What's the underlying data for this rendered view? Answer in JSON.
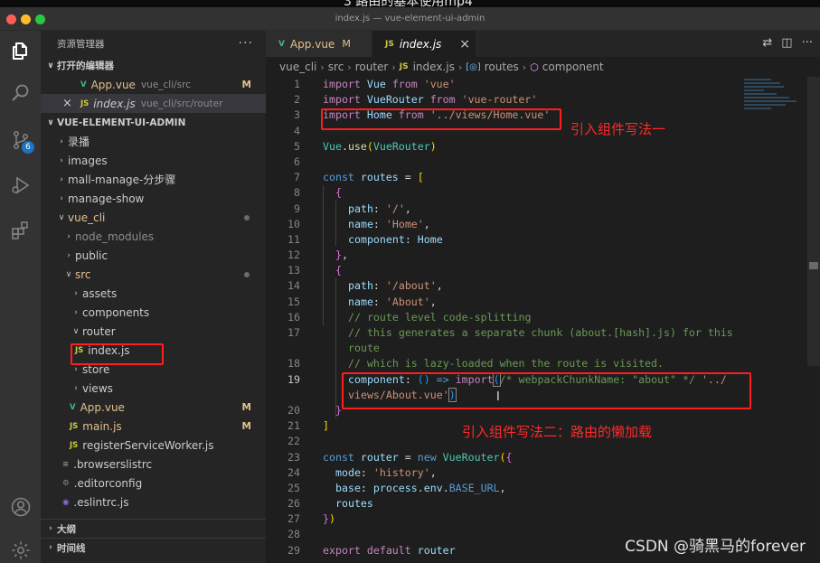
{
  "caption_text": "3 路由的基本使用mp4",
  "window_title": "index.js — vue-element-ui-admin",
  "activity_bar": {
    "icons": [
      "files-icon",
      "search-icon",
      "source-control-icon",
      "run-debug-icon",
      "extensions-icon",
      "account-icon",
      "settings-gear-icon"
    ],
    "scm_badge": "6"
  },
  "sidebar": {
    "title": "资源管理器",
    "more": "···",
    "open_editors_title": "打开的编辑器",
    "open_editors": [
      {
        "name": "App.vue",
        "path": "vue_cli/src",
        "status": "M",
        "icon": "V"
      },
      {
        "name": "index.js",
        "path": "vue_cli/src/router",
        "status": "",
        "icon": "JS",
        "close": "×"
      }
    ],
    "project_title": "VUE-ELEMENT-UI-ADMIN",
    "tree": [
      {
        "label": "录播",
        "kind": "folder"
      },
      {
        "label": "images",
        "kind": "folder"
      },
      {
        "label": "mall-manage-分步骤",
        "kind": "folder"
      },
      {
        "label": "manage-show",
        "kind": "folder"
      },
      {
        "label": "vue_cli",
        "kind": "folder-open"
      },
      {
        "label": "node_modules",
        "kind": "folder"
      },
      {
        "label": "public",
        "kind": "folder"
      },
      {
        "label": "src",
        "kind": "folder-open"
      },
      {
        "label": "assets",
        "kind": "folder"
      },
      {
        "label": "components",
        "kind": "folder"
      },
      {
        "label": "router",
        "kind": "folder-open"
      },
      {
        "label": "index.js",
        "kind": "js"
      },
      {
        "label": "store",
        "kind": "folder"
      },
      {
        "label": "views",
        "kind": "folder"
      },
      {
        "label": "App.vue",
        "kind": "vue",
        "status": "M"
      },
      {
        "label": "main.js",
        "kind": "js",
        "status": "M"
      },
      {
        "label": "registerServiceWorker.js",
        "kind": "js"
      },
      {
        "label": ".browserslistrc",
        "kind": "cfg"
      },
      {
        "label": ".editorconfig",
        "kind": "cfg"
      },
      {
        "label": ".eslintrc.js",
        "kind": "cfg"
      }
    ],
    "outline_title": "大纲",
    "timeline_title": "时间线"
  },
  "editor": {
    "tabs": [
      {
        "label": "App.vue",
        "icon": "V",
        "status": "M"
      },
      {
        "label": "index.js",
        "icon": "JS",
        "close": "×"
      }
    ],
    "breadcrumbs": [
      "vue_cli",
      "src",
      "router",
      "index.js",
      "routes",
      "component"
    ],
    "breadcrumb_icons": {
      "file": "JS",
      "symbol1": "[◎]",
      "symbol2": "⬡"
    },
    "line_numbers": [
      "1",
      "2",
      "3",
      "4",
      "5",
      "6",
      "7",
      "8",
      "9",
      "10",
      "11",
      "12",
      "13",
      "14",
      "15",
      "16",
      "17",
      "",
      "18",
      "19",
      "",
      "20",
      "21",
      "22",
      "23",
      "24",
      "25",
      "26",
      "27",
      "28",
      "29"
    ],
    "code": {
      "l1": [
        "import",
        " ",
        "Vue",
        " ",
        "from",
        " ",
        "'vue'"
      ],
      "l2": [
        "import",
        " ",
        "VueRouter",
        " ",
        "from",
        " ",
        "'vue-router'"
      ],
      "l3": [
        "import",
        " ",
        "Home",
        " ",
        "from",
        " ",
        "'../views/Home.vue'"
      ],
      "l5": [
        "Vue",
        ".",
        "use",
        "(",
        "VueRouter",
        ")"
      ],
      "l7": [
        "const",
        " ",
        "routes",
        " = ",
        "["
      ],
      "l8": [
        "{"
      ],
      "l9": [
        "path",
        ": ",
        "'/'",
        ","
      ],
      "l10": [
        "name",
        ": ",
        "'Home'",
        ","
      ],
      "l11": [
        "component",
        ": ",
        "Home"
      ],
      "l12": [
        "}",
        ","
      ],
      "l13": [
        "{"
      ],
      "l14": [
        "path",
        ": ",
        "'/about'",
        ","
      ],
      "l15": [
        "name",
        ": ",
        "'About'",
        ","
      ],
      "l16": [
        "// route level code-splitting"
      ],
      "l17a": [
        "// this generates a separate chunk (about.[hash].js) for this"
      ],
      "l17b": [
        "route"
      ],
      "l18": [
        "// which is lazy-loaded when the route is visited."
      ],
      "l19a": [
        "component",
        ": ",
        "()",
        " => ",
        "import",
        "(",
        "/* webpackChunkName: \"about\" */",
        " ",
        "'../"
      ],
      "l19b": [
        "views/About.vue'",
        ")"
      ],
      "l20": [
        "}"
      ],
      "l21": [
        "]"
      ],
      "l23": [
        "const",
        " ",
        "router",
        " = ",
        "new",
        " ",
        "VueRouter",
        "(",
        "{"
      ],
      "l24": [
        "mode",
        ": ",
        "'history'",
        ","
      ],
      "l25": [
        "base",
        ": ",
        "process",
        ".",
        "env",
        ".",
        "BASE_URL",
        ","
      ],
      "l26": [
        "routes"
      ],
      "l27": [
        "}",
        ")"
      ],
      "l29": [
        "export",
        " ",
        "default",
        " ",
        "router"
      ]
    },
    "annotation_1": "引入组件写法一",
    "annotation_2": "引入组件写法二：路由的懒加载",
    "cursor_glyph": "I"
  },
  "watermark": "CSDN @骑黑马的forever",
  "colors": {
    "highlight_box": "#ff1d1d",
    "keyword": "#569cd6",
    "control_keyword": "#c586c0",
    "string": "#ce9178",
    "comment": "#6a9955",
    "class": "#4ec9b0",
    "property": "#9cdcfe"
  }
}
